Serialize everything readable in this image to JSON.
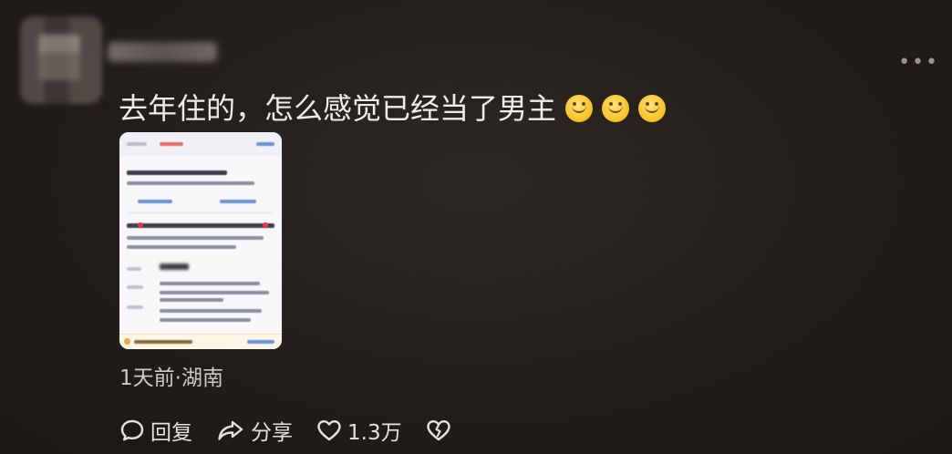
{
  "comment": {
    "text": "去年住的，怎么感觉已经当了男主",
    "emojis": [
      "grin-emoji",
      "grin-emoji",
      "grin-emoji"
    ]
  },
  "meta": {
    "time_location": "1天前·湖南"
  },
  "actions": {
    "reply_label": "回复",
    "share_label": "分享",
    "like_count": "1.3万"
  },
  "colors": {
    "background": "#221d1a",
    "text": "#f1ece8",
    "muted": "#cfc9c4"
  }
}
